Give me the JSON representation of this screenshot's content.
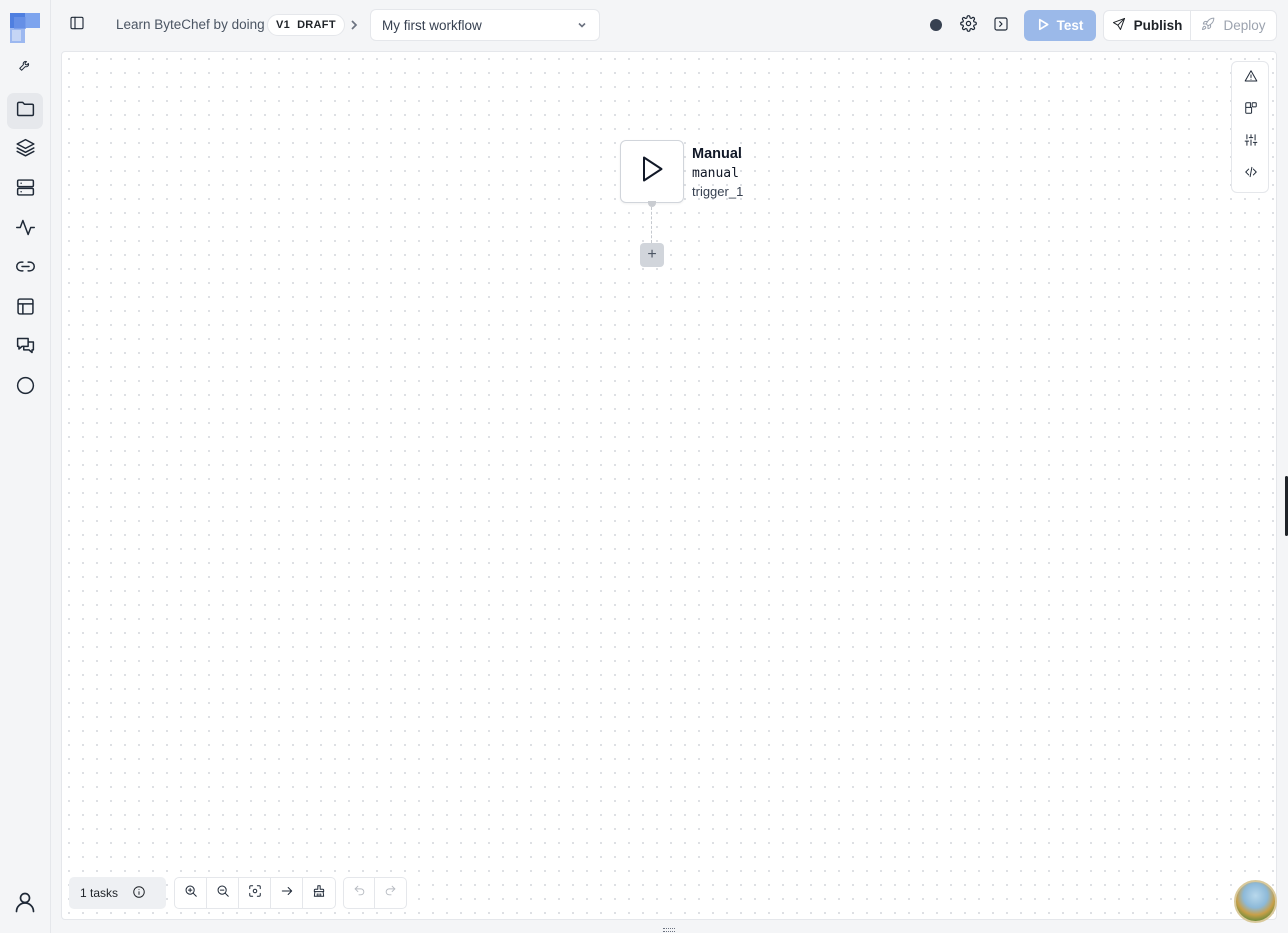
{
  "header": {
    "project_name": "Learn ByteChef by doing",
    "version": "V1",
    "status": "DRAFT",
    "workflow_select_value": "My first workflow",
    "test_label": "Test",
    "publish_label": "Publish",
    "deploy_label": "Deploy"
  },
  "sidebar": {
    "items": [
      {
        "icon": "wrench-icon"
      },
      {
        "icon": "folder-icon"
      },
      {
        "icon": "layers-icon"
      },
      {
        "icon": "server-icon"
      },
      {
        "icon": "activity-icon"
      },
      {
        "icon": "link-icon"
      },
      {
        "icon": "table-icon"
      },
      {
        "icon": "messages-icon"
      },
      {
        "icon": "circle-icon"
      }
    ]
  },
  "canvas": {
    "node": {
      "title": "Manual",
      "type": "manual",
      "name": "trigger_1"
    },
    "add_node_symbol": "+"
  },
  "footer": {
    "tasks_label": "1 tasks"
  },
  "colors": {
    "accent_disabled": "#9bb9e9",
    "canvas_bg": "#ffffff",
    "app_bg": "#f4f5f7"
  }
}
